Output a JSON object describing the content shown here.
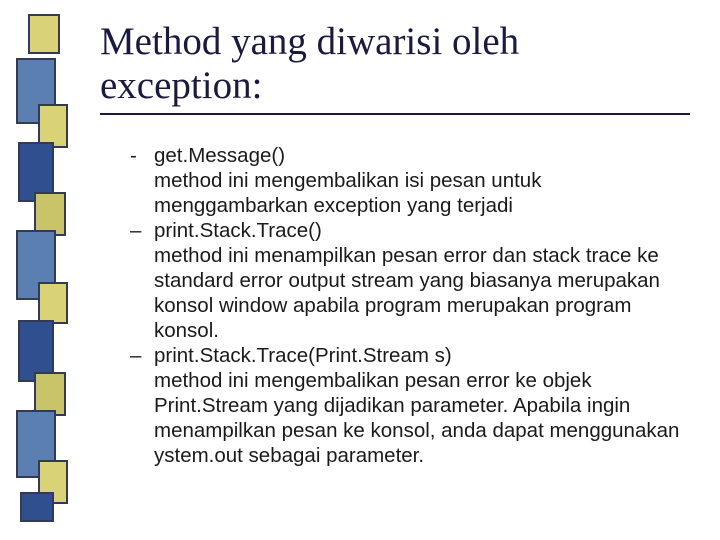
{
  "title": "Method yang diwarisi oleh exception:",
  "items": [
    {
      "bullet": "-",
      "name": "get.Message()",
      "desc": "method ini mengembalikan isi pesan untuk menggambarkan exception yang terjadi"
    },
    {
      "bullet": "–",
      "name": "print.Stack.Trace()",
      "desc": "method ini menampilkan pesan error dan stack trace ke standard error output stream yang biasanya merupakan konsol window apabila program merupakan program konsol."
    },
    {
      "bullet": "–",
      "name": "print.Stack.Trace(Print.Stream s)",
      "desc": "method ini mengembalikan pesan error ke objek Print.Stream yang dijadikan parameter. Apabila ingin menampilkan pesan ke konsol, anda dapat menggunakan ystem.out sebagai parameter."
    }
  ],
  "sidebar_blocks": [
    {
      "l": 12,
      "t": 0,
      "w": 32,
      "h": 40,
      "c": "#d9d276"
    },
    {
      "l": 0,
      "t": 44,
      "w": 40,
      "h": 66,
      "c": "#5a7fb0"
    },
    {
      "l": 22,
      "t": 90,
      "w": 30,
      "h": 44,
      "c": "#d9d276"
    },
    {
      "l": 2,
      "t": 128,
      "w": 36,
      "h": 60,
      "c": "#2f4f8f"
    },
    {
      "l": 18,
      "t": 178,
      "w": 32,
      "h": 44,
      "c": "#c9c46a"
    },
    {
      "l": 0,
      "t": 216,
      "w": 40,
      "h": 70,
      "c": "#5a7fb0"
    },
    {
      "l": 22,
      "t": 268,
      "w": 30,
      "h": 42,
      "c": "#d9d276"
    },
    {
      "l": 2,
      "t": 306,
      "w": 36,
      "h": 62,
      "c": "#2f4f8f"
    },
    {
      "l": 18,
      "t": 358,
      "w": 32,
      "h": 44,
      "c": "#c9c46a"
    },
    {
      "l": 0,
      "t": 396,
      "w": 40,
      "h": 68,
      "c": "#5a7fb0"
    },
    {
      "l": 22,
      "t": 446,
      "w": 30,
      "h": 44,
      "c": "#d9d276"
    },
    {
      "l": 4,
      "t": 478,
      "w": 34,
      "h": 30,
      "c": "#2f4f8f"
    }
  ]
}
